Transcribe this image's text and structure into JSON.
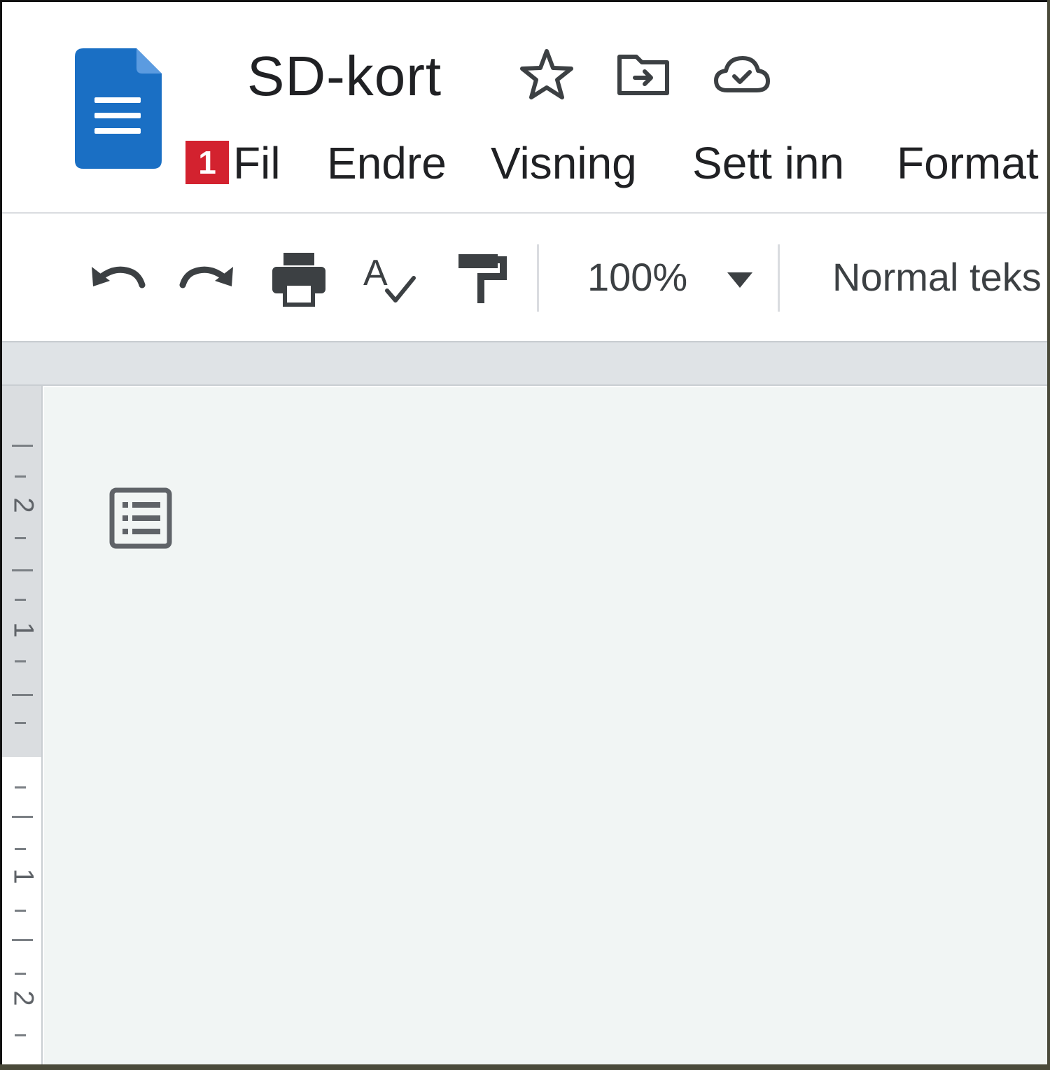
{
  "document": {
    "title": "SD-kort"
  },
  "menu": {
    "badge": "1",
    "items": [
      "Fil",
      "Endre",
      "Visning",
      "Sett inn",
      "Format"
    ]
  },
  "toolbar": {
    "zoom": "100%",
    "paragraph_style": "Normal teks"
  },
  "ruler": {
    "labels": [
      "2",
      "1",
      "1",
      "2"
    ]
  },
  "colors": {
    "docs_blue": "#1a73e8",
    "badge_red": "#d3222f",
    "canvas": "#f1f5f4"
  },
  "icons": {
    "logo": "google-docs-logo-icon",
    "title_icons": [
      "star-icon",
      "move-to-folder-icon",
      "cloud-saved-icon"
    ],
    "toolbar_icons": [
      "undo-icon",
      "redo-icon",
      "print-icon",
      "spellcheck-icon",
      "paint-format-icon",
      "chevron-down-icon"
    ],
    "canvas_icon": "document-outline-icon"
  }
}
